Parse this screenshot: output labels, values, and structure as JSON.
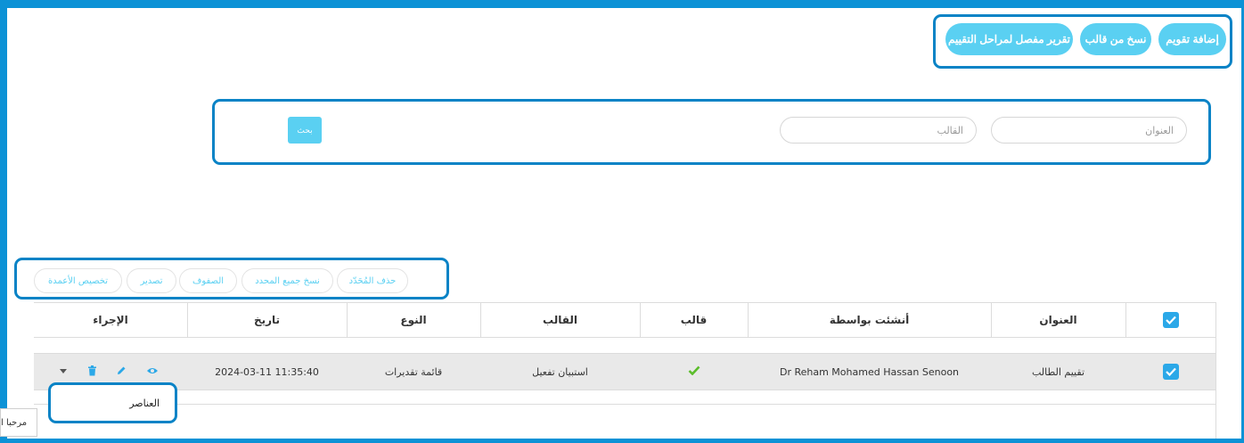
{
  "header_actions": {
    "add_evaluation": "إضافة تقويم",
    "copy_from_template": "نسخ من قالب",
    "detailed_report": "تقرير مفصل لمراحل التقييم"
  },
  "search": {
    "title_placeholder": "العنوان",
    "template_placeholder": "القالب",
    "search_button": "بحث"
  },
  "toolbar": {
    "delete_selected": "حذف المُحَدّد",
    "copy_selected": "نسخ جميع المحدد",
    "rows": "الصفوف",
    "export": "تصدير",
    "customize_columns": "تخصيص الأعمدة"
  },
  "table": {
    "headers": {
      "title": "العنوان",
      "created_by": "أنشئت بواسطة",
      "is_template": "قالب",
      "template": "القالب",
      "type": "النوع",
      "date": "تاريخ",
      "actions": "الإجراء"
    },
    "rows": [
      {
        "title": "تقييم الطالب",
        "created_by": "Dr Reham Mohamed Hassan Senoon",
        "template": "استبيان تفعيل",
        "type": "قائمة تقديرات",
        "date": "2024-03-11 11:35:40"
      }
    ]
  },
  "actions_dropdown": {
    "item": "العناصر"
  },
  "welcome_tab": "مرحبا ا",
  "colors": {
    "frame": "#0c92d6",
    "highlight": "#0a83c6",
    "accent": "#5ad0f2",
    "checkbox": "#2ba8e8",
    "selected_row": "#e9e9e9",
    "check_green": "#5bbd2b"
  },
  "icons": {
    "view": "eye-icon",
    "edit": "pencil-icon",
    "delete": "trash-icon",
    "more": "caret-down-icon",
    "template_yes": "green-check-icon"
  }
}
